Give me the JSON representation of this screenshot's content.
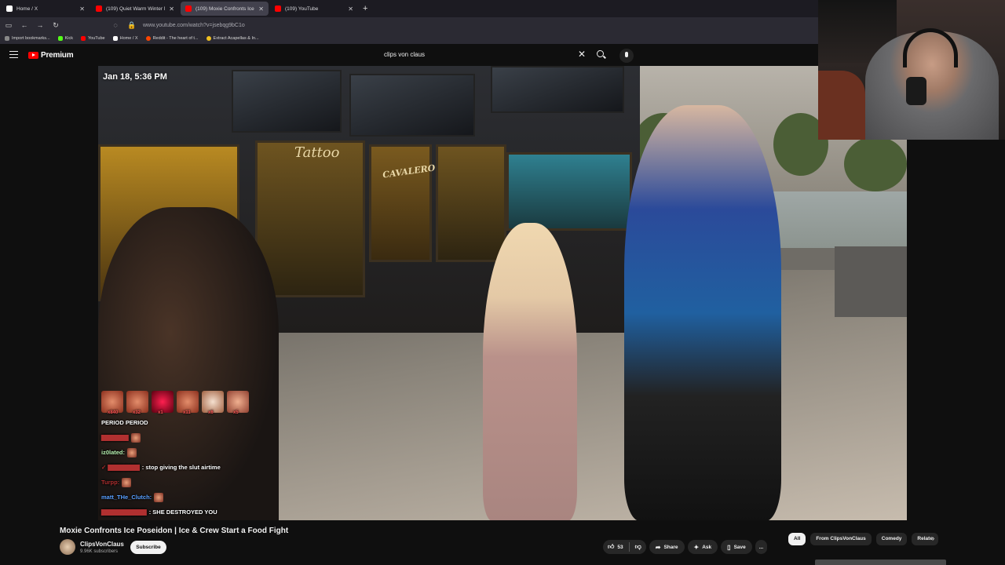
{
  "browser": {
    "tabs": [
      {
        "title": "Home / X",
        "favicon_color": "#ffffff"
      },
      {
        "title": "(109) Quiet Warm Winter Night",
        "favicon_color": "#ff0000"
      },
      {
        "title": "(109) Moxie Confronts Ice P",
        "favicon_color": "#ff0000"
      },
      {
        "title": "(109) YouTube",
        "favicon_color": "#ff0000"
      }
    ],
    "new_tab": "+",
    "url": "www.youtube.com/watch?v=jsebqg9bC1o",
    "bookmarks": [
      {
        "label": "Import bookmarks...",
        "color": "#888888"
      },
      {
        "label": "Kick",
        "color": "#53fc18"
      },
      {
        "label": "YouTube",
        "color": "#ff0000"
      },
      {
        "label": "Home / X",
        "color": "#ffffff"
      },
      {
        "label": "Reddit - The heart of t...",
        "color": "#ff4500"
      },
      {
        "label": "Extract Acapellas & In...",
        "color": "#f0c020"
      }
    ]
  },
  "youtube": {
    "logo_text": "Premium",
    "search_query": "clips von claus"
  },
  "video": {
    "timestamp_overlay": "Jan 18, 5:36 PM",
    "shop_sign": "Tattoo",
    "shop_sign_2": "CAVALERO",
    "chat": {
      "emote_counts": [
        "x840",
        "x32",
        "x1",
        "x11",
        "x6",
        "x5"
      ],
      "lines": [
        {
          "user": "",
          "message": "PERIOD PERIOD"
        },
        {
          "user": "",
          "message": ""
        },
        {
          "user": "iz0lated:",
          "message": ""
        },
        {
          "user": "",
          "message": ": stop giving the slut airtime"
        },
        {
          "user": "Turpp:",
          "message": ""
        },
        {
          "user": "matt_THe_Clutch:",
          "message": ""
        },
        {
          "user": "",
          "message": ": SHE DESTROYED YOU"
        }
      ]
    }
  },
  "details": {
    "title": "Moxie Confronts Ice Poseidon | Ice & Crew Start a Food Fight",
    "channel_name": "ClipsVonClaus",
    "subscribers": "9.96K subscribers",
    "subscribe_label": "Subscribe",
    "likes": "53",
    "share_label": "Share",
    "ask_label": "Ask",
    "save_label": "Save",
    "more_label": "...",
    "chips": [
      "All",
      "From ClipsVonClaus",
      "Comedy",
      "Relate"
    ]
  },
  "colors": {
    "accent": "#ff0000",
    "background": "#0f0f0f",
    "pill": "#272727"
  }
}
